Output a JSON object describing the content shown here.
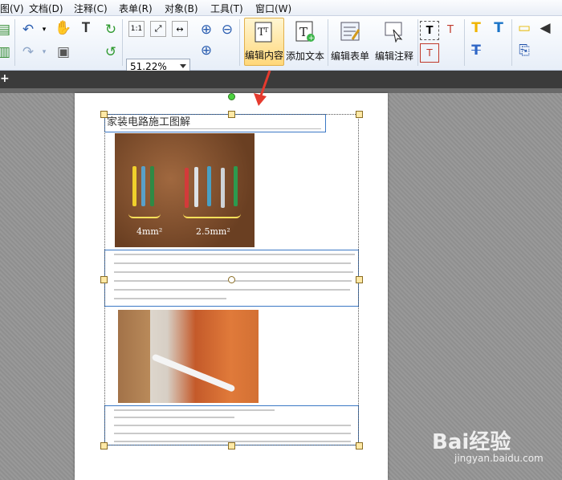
{
  "menu": [
    "图(V)",
    "文档(D)",
    "注释(C)",
    "表单(R)",
    "对象(B)",
    "工具(T)",
    "窗口(W)"
  ],
  "toolbar": {
    "zoom_value": "51.22%",
    "buttons": {
      "edit_content": "编辑内容",
      "add_text": "添加文本",
      "edit_form": "编辑表单",
      "edit_annotation": "编辑注释"
    }
  },
  "tabstrip": {
    "plus": "+"
  },
  "document": {
    "title": "家装电路施工图解",
    "photo1_labels": [
      "4mm²",
      "2.5mm²"
    ]
  },
  "watermark": {
    "brand": "Bai经验",
    "url": "jingyan.baidu.com"
  },
  "colors": {
    "accent": "#3b78c5",
    "active_button": "#ffd77a",
    "arrow": "#e53a2e"
  }
}
